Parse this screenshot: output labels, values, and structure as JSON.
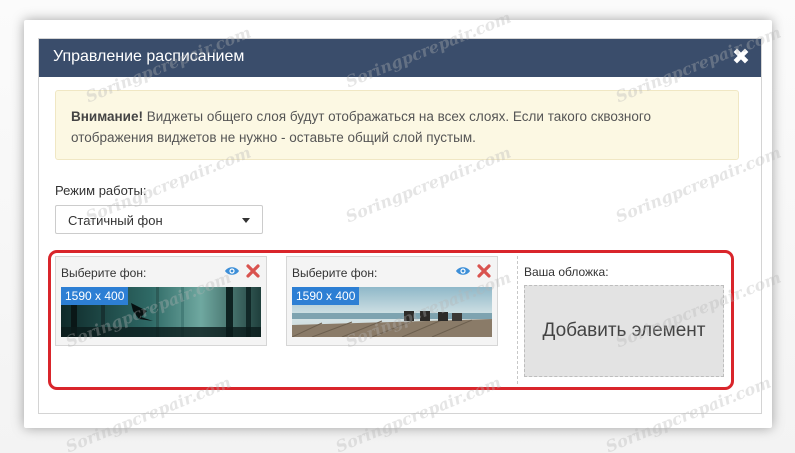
{
  "modal": {
    "title": "Управление расписанием",
    "close_symbol": "✖"
  },
  "alert": {
    "strong": "Внимание!",
    "text": " Виджеты общего слоя будут отображаться на всех слоях. Если такого сквозного отображения виджетов не нужно - оставьте общий слой пустым."
  },
  "mode": {
    "label": "Режим работы:",
    "selected": "Статичный фон"
  },
  "backgrounds": [
    {
      "label": "Выберите фон:",
      "size": "1590 x 400"
    },
    {
      "label": "Выберите фон:",
      "size": "1590 x 400"
    }
  ],
  "cover": {
    "label": "Ваша обложка:",
    "add_label": "Добавить элемент"
  },
  "watermark": "Soringpcrepair.com",
  "colors": {
    "header": "#3a4d6b",
    "alert_bg": "#fcf8e3",
    "badge": "#2d7fd4",
    "highlight": "#d9252b",
    "eye": "#3d8fd8",
    "delete": "#d9534f"
  }
}
